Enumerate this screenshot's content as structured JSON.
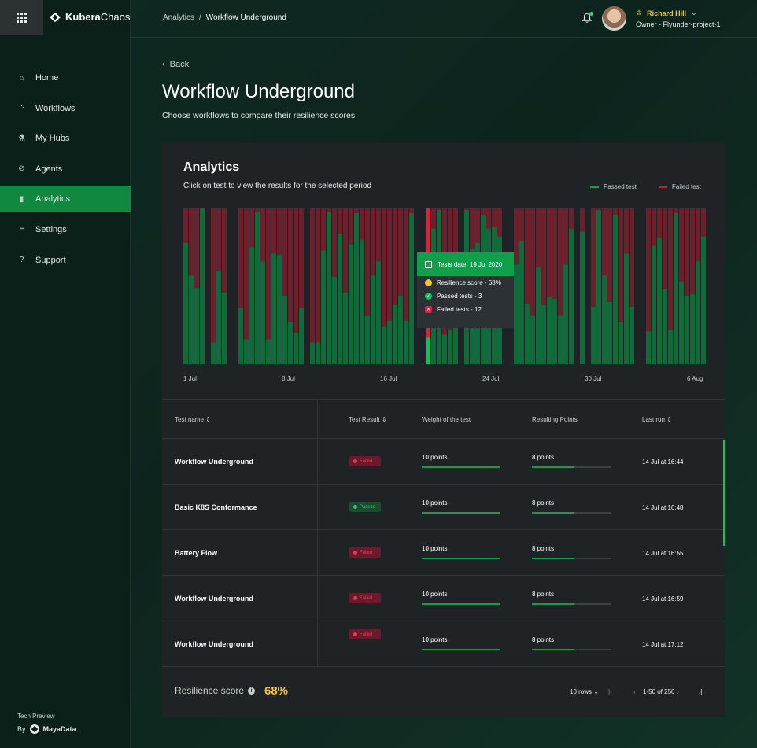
{
  "app": {
    "brand_bold": "Kubera",
    "brand_light": "Chaos"
  },
  "topbar": {
    "breadcrumb_root": "Analytics",
    "breadcrumb_sep": "/",
    "breadcrumb_current": "Workflow Underground",
    "user_name": "Richard Hill",
    "user_role": "Owner - Flyunder-project-1"
  },
  "sidebar": {
    "items": [
      {
        "label": "Home",
        "icon": "home-icon",
        "glyph": "⌂"
      },
      {
        "label": "Workflows",
        "icon": "workflows-icon",
        "glyph": "⁘"
      },
      {
        "label": "My Hubs",
        "icon": "flask-icon",
        "glyph": "⚗"
      },
      {
        "label": "Agents",
        "icon": "link-icon",
        "glyph": "⊘"
      },
      {
        "label": "Analytics",
        "icon": "chart-icon",
        "glyph": "▮"
      },
      {
        "label": "Settings",
        "icon": "sliders-icon",
        "glyph": "≡"
      },
      {
        "label": "Support",
        "icon": "help-icon",
        "glyph": "?"
      }
    ],
    "active_index": 4,
    "tech_preview": "Tech Preview",
    "by_label": "By",
    "by_brand": "MayaData"
  },
  "header": {
    "back": "Back",
    "title": "Workflow Underground",
    "subtitle": "Choose workflows to compare their resilience scores"
  },
  "analytics": {
    "title": "Analytics",
    "subtitle": "Click on test to view the results for the selected period",
    "legend_passed": "Passed test",
    "legend_failed": "Failed test"
  },
  "chart_data": {
    "type": "bar",
    "stacked": true,
    "x_tick_labels": [
      "1 Jul",
      "8 Jul",
      "16 Jul",
      "24 Jul",
      "30 Jul",
      "6 Aug"
    ],
    "series_colors": {
      "passed": "#0e6b3a",
      "failed": "#6e1f2c",
      "passed_highlight": "#10c05a",
      "failed_highlight": "#e01e3c"
    },
    "bars": [
      {
        "i": 0,
        "p": 0.78
      },
      {
        "i": 1,
        "p": 0.57
      },
      {
        "i": 2,
        "p": 0.49
      },
      {
        "i": 3,
        "p": 1.0
      },
      {
        "i": 5,
        "p": 0.14
      },
      {
        "i": 6,
        "p": 0.6
      },
      {
        "i": 7,
        "p": 0.46
      },
      {
        "i": 10,
        "p": 0.36
      },
      {
        "i": 11,
        "p": 0.16
      },
      {
        "i": 12,
        "p": 0.75
      },
      {
        "i": 13,
        "p": 0.98
      },
      {
        "i": 14,
        "p": 0.66
      },
      {
        "i": 15,
        "p": 0.16
      },
      {
        "i": 16,
        "p": 0.71
      },
      {
        "i": 17,
        "p": 0.7
      },
      {
        "i": 18,
        "p": 0.44
      },
      {
        "i": 19,
        "p": 0.27
      },
      {
        "i": 20,
        "p": 0.2
      },
      {
        "i": 21,
        "p": 0.36
      },
      {
        "i": 23,
        "p": 0.14
      },
      {
        "i": 24,
        "p": 0.14
      },
      {
        "i": 25,
        "p": 0.73
      },
      {
        "i": 26,
        "p": 0.98
      },
      {
        "i": 27,
        "p": 0.56
      },
      {
        "i": 28,
        "p": 0.84
      },
      {
        "i": 29,
        "p": 0.46
      },
      {
        "i": 30,
        "p": 0.77
      },
      {
        "i": 31,
        "p": 0.97
      },
      {
        "i": 32,
        "p": 0.8
      },
      {
        "i": 33,
        "p": 0.31
      },
      {
        "i": 34,
        "p": 0.57
      },
      {
        "i": 35,
        "p": 0.66
      },
      {
        "i": 36,
        "p": 0.24
      },
      {
        "i": 37,
        "p": 0.28
      },
      {
        "i": 38,
        "p": 0.38
      },
      {
        "i": 39,
        "p": 0.44
      },
      {
        "i": 40,
        "p": 0.28
      },
      {
        "i": 41,
        "p": 0.97
      },
      {
        "i": 44,
        "p": 0.17
      },
      {
        "i": 45,
        "p": 0.87
      },
      {
        "i": 46,
        "p": 0.99
      },
      {
        "i": 47,
        "p": 0.19
      },
      {
        "i": 48,
        "p": 0.22
      },
      {
        "i": 49,
        "p": 0.38
      },
      {
        "i": 51,
        "p": 0.99
      },
      {
        "i": 52,
        "p": 0.74
      },
      {
        "i": 53,
        "p": 0.78
      },
      {
        "i": 54,
        "p": 0.96
      },
      {
        "i": 55,
        "p": 0.87
      },
      {
        "i": 56,
        "p": 0.88
      },
      {
        "i": 57,
        "p": 0.82
      },
      {
        "i": 60,
        "p": 0.64
      },
      {
        "i": 61,
        "p": 0.79
      },
      {
        "i": 62,
        "p": 0.39
      },
      {
        "i": 63,
        "p": 0.31
      },
      {
        "i": 64,
        "p": 0.62
      },
      {
        "i": 65,
        "p": 0.38
      },
      {
        "i": 66,
        "p": 0.43
      },
      {
        "i": 67,
        "p": 0.42
      },
      {
        "i": 68,
        "p": 0.31
      },
      {
        "i": 69,
        "p": 0.64
      },
      {
        "i": 70,
        "p": 0.87
      },
      {
        "i": 72,
        "p": 0.85
      },
      {
        "i": 74,
        "p": 0.37
      },
      {
        "i": 75,
        "p": 0.99
      },
      {
        "i": 76,
        "p": 0.57
      },
      {
        "i": 77,
        "p": 0.4
      },
      {
        "i": 78,
        "p": 0.96
      },
      {
        "i": 79,
        "p": 0.27
      },
      {
        "i": 80,
        "p": 0.71
      },
      {
        "i": 81,
        "p": 0.37
      },
      {
        "i": 84,
        "p": 0.21
      },
      {
        "i": 85,
        "p": 0.76
      },
      {
        "i": 86,
        "p": 0.81
      },
      {
        "i": 87,
        "p": 0.48
      },
      {
        "i": 88,
        "p": 0.22
      },
      {
        "i": 89,
        "p": 0.97
      },
      {
        "i": 90,
        "p": 0.53
      },
      {
        "i": 91,
        "p": 0.44
      },
      {
        "i": 92,
        "p": 0.45
      },
      {
        "i": 93,
        "p": 0.66
      },
      {
        "i": 94,
        "p": 0.82
      }
    ],
    "selected_index": 44
  },
  "tooltip": {
    "date": "Tests date: 19 Jul 2020",
    "score": "Resilience score - 68%",
    "passed": "Passed tests - 3",
    "failed": "Failed tests - 12"
  },
  "table": {
    "headers": {
      "name": "Test name",
      "result": "Test Result",
      "weight": "Weight of the test",
      "points": "Resulting Points",
      "last_run": "Last run"
    },
    "rows": [
      {
        "name": "Workflow Underground",
        "result": "Failed",
        "weight": "10 points",
        "points": "8 points",
        "last_run": "14 Jul at 16:44",
        "weight_fill": 1.0,
        "points_fill": 0.54
      },
      {
        "name": "Basic K8S Conformance",
        "result": "Passed",
        "weight": "10 points",
        "points": "8 points",
        "last_run": "14 Jul at 16:48",
        "weight_fill": 1.0,
        "points_fill": 0.54
      },
      {
        "name": "Battery Flow",
        "result": "Failed",
        "weight": "10 points",
        "points": "8 points",
        "last_run": "14 Jul at 16:55",
        "weight_fill": 1.0,
        "points_fill": 0.54
      },
      {
        "name": "Workflow Underground",
        "result": "Failed",
        "weight": "10 points",
        "points": "8 points",
        "last_run": "14 Jul at 16:59",
        "weight_fill": 1.0,
        "points_fill": 0.54
      },
      {
        "name": "Workflow Underground",
        "result": "Failed",
        "weight": "10 points",
        "points": "8 points",
        "last_run": "14 Jul at 17:12",
        "weight_fill": 1.0,
        "points_fill": 0.54
      }
    ]
  },
  "footer": {
    "resilience_label": "Resilience score",
    "resilience_value": "68%",
    "rows_per_page": "10 rows",
    "range": "1-50 of 250"
  }
}
